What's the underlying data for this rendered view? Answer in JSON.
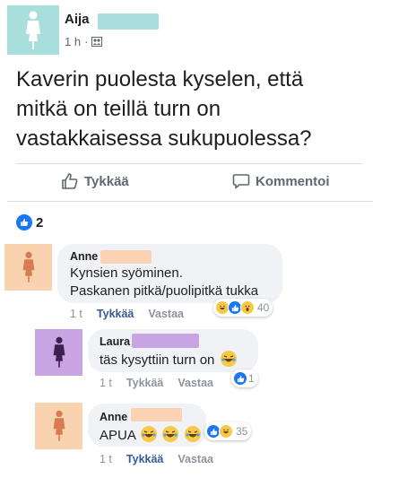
{
  "post": {
    "author": "Aija",
    "time": "1 h",
    "separator": "·",
    "audience_icon": "friends-icon",
    "text_lines": [
      "Kaverin puolesta kyselen, että",
      "mitkä on teillä turn on",
      "vastakkaisessa sukupuolessa?"
    ],
    "avatar_color": "#a8dedb",
    "name_redaction_color": "#a8dedb"
  },
  "actions": {
    "like_label": "Tykkää",
    "comment_label": "Kommentoi"
  },
  "reactions": {
    "count": "2",
    "icon": "like-icon"
  },
  "comments": [
    {
      "name": "Anne",
      "lines": [
        "Kynsien syöminen.",
        "Paskanen pitkä/puolipitkä tukka"
      ],
      "time": "1 t",
      "like_label": "Tykkää",
      "reply_label": "Vastaa",
      "reaction_count": "40",
      "reaction_icons": [
        "haha-icon",
        "like-icon",
        "wow-icon"
      ],
      "avatar_color": "#f9d2b0",
      "like_active": true
    },
    {
      "name": "Laura",
      "lines": [
        "täs kysyttiin turn on"
      ],
      "time": "1 t",
      "like_label": "Tykkää",
      "reply_label": "Vastaa",
      "reaction_count": "1",
      "reaction_icons": [
        "like-icon"
      ],
      "avatar_color": "#c9a4e3",
      "like_active": false
    },
    {
      "name": "Anne",
      "lines": [
        "APUA"
      ],
      "time": "1 t",
      "like_label": "Tykkää",
      "reply_label": "Vastaa",
      "reaction_count": "35",
      "reaction_icons": [
        "like-icon",
        "haha-icon"
      ],
      "avatar_color": "#f9d2b0",
      "like_active": true
    }
  ],
  "colors": {
    "accent": "#385898",
    "like_blue": "#1877f2",
    "muted": "#606770"
  }
}
